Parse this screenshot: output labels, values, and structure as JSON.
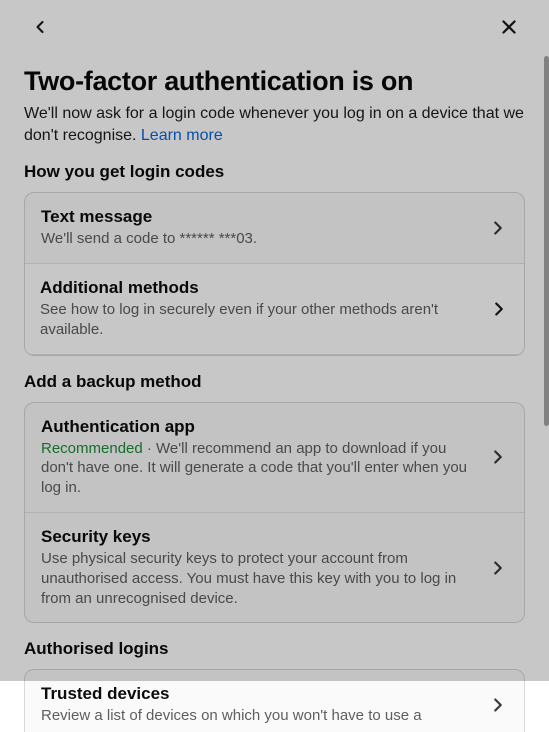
{
  "header": {
    "title": "Two-factor authentication is on",
    "subtitle_part1": "We'll now ask for a login code whenever you log in on a device that we don't recognise. ",
    "learn_more": "Learn more"
  },
  "sections": {
    "login_codes": "How you get login codes",
    "backup": "Add a backup method",
    "authorised": "Authorised logins"
  },
  "rows": {
    "text_message": {
      "title": "Text message",
      "desc": "We'll send a code to ****** ***03."
    },
    "additional": {
      "title": "Additional methods",
      "desc": "See how to log in securely even if your other methods aren't available."
    },
    "auth_app": {
      "title": "Authentication app",
      "recommended": "Recommended",
      "desc_rest": " · We'll recommend an app to download if you don't have one. It will generate a code that you'll enter when you log in."
    },
    "security_keys": {
      "title": "Security keys",
      "desc": "Use physical security keys to protect your account from unauthorised access. You must have this key with you to log in from an unrecognised device."
    },
    "trusted": {
      "title": "Trusted devices",
      "desc": "Review a list of devices on which you won't have to use a"
    }
  }
}
